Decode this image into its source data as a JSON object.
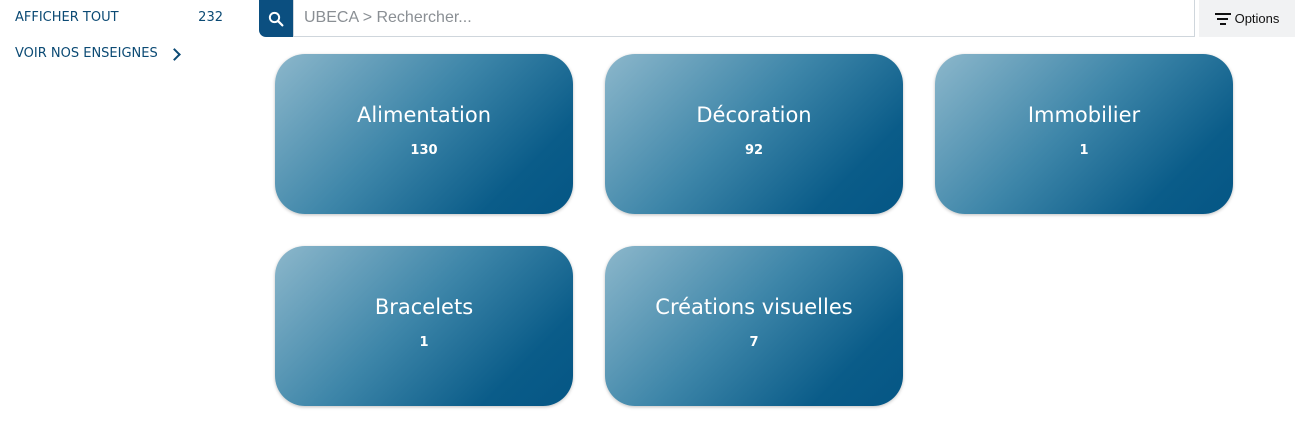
{
  "sidebar": {
    "show_all_label": "AFFICHER TOUT",
    "show_all_count": "232",
    "brands_label": "VOIR NOS ENSEIGNES"
  },
  "search": {
    "placeholder": "UBECA > Rechercher...",
    "value": ""
  },
  "toolbar": {
    "options_label": "Options"
  },
  "categories": [
    {
      "label": "Alimentation",
      "count": "130"
    },
    {
      "label": "Décoration",
      "count": "92"
    },
    {
      "label": "Immobilier",
      "count": "1"
    },
    {
      "label": "Bracelets",
      "count": "1"
    },
    {
      "label": "Créations visuelles",
      "count": "7"
    }
  ],
  "colors": {
    "primary": "#0b4f80",
    "card_gradient_start": "#8cb7cb",
    "card_gradient_end": "#055685"
  },
  "icons": {
    "search": "search-icon",
    "options": "filter-icon",
    "brands": "chevron-right-icon"
  }
}
